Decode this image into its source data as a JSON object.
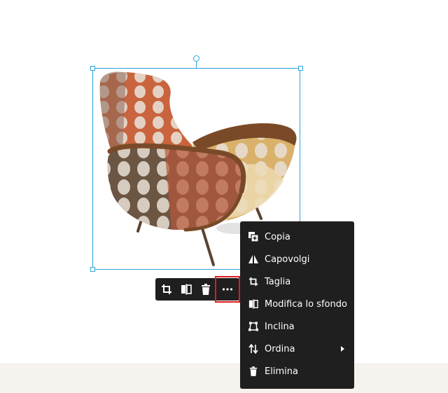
{
  "colors": {
    "selection": "#2aa3d6",
    "toolbar_bg": "#1f1f1f",
    "highlight": "#e01b1b"
  },
  "canvas": {
    "image_name": "armchair-photo"
  },
  "toolbar": {
    "buttons": [
      {
        "icon": "crop-icon"
      },
      {
        "icon": "edit-background-icon"
      },
      {
        "icon": "trash-icon"
      },
      {
        "icon": "more-icon"
      }
    ]
  },
  "context_menu": {
    "items": [
      {
        "label": "Copia",
        "icon": "copy-icon"
      },
      {
        "label": "Capovolgi",
        "icon": "flip-icon"
      },
      {
        "label": "Taglia",
        "icon": "crop-icon"
      },
      {
        "label": "Modifica lo sfondo",
        "icon": "edit-background-icon"
      },
      {
        "label": "Inclina",
        "icon": "skew-icon"
      },
      {
        "label": "Ordina",
        "icon": "sort-icon",
        "has_submenu": true
      },
      {
        "label": "Elimina",
        "icon": "trash-icon"
      }
    ]
  }
}
